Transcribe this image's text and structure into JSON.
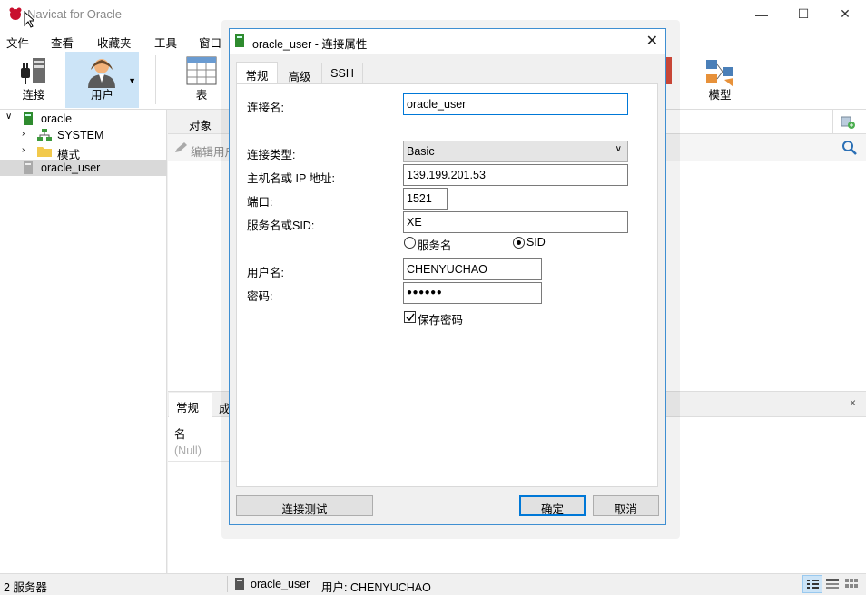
{
  "app": {
    "title": "Navicat for Oracle",
    "menu": [
      "文件",
      "查看",
      "收藏夹",
      "工具",
      "窗口"
    ],
    "toolbar": {
      "connect_label": "连接",
      "user_label": "用户",
      "table_label": "表",
      "model_label": "模型"
    },
    "tree": {
      "items": [
        {
          "label": "oracle"
        },
        {
          "label": "SYSTEM"
        },
        {
          "label": "模式"
        },
        {
          "label": "oracle_user"
        }
      ]
    },
    "content": {
      "objects_tab": "对象",
      "edit_user_partial": "编辑用户"
    },
    "lower_panel": {
      "tab_general": "常规",
      "tab_other_partial": "成",
      "name_header": "名",
      "name_value": "(Null)"
    },
    "status": {
      "servers": "2 服务器",
      "connection": "oracle_user",
      "user": "用户: CHENYUCHAO"
    }
  },
  "dialog": {
    "title": "oracle_user - 连接属性",
    "tabs": [
      "常规",
      "高级",
      "SSH"
    ],
    "form": {
      "conn_name_label": "连接名:",
      "conn_name_value": "oracle_user",
      "conn_type_label": "连接类型:",
      "conn_type_value": "Basic",
      "host_label": "主机名或 IP 地址:",
      "host_value": "139.199.201.53",
      "port_label": "端口:",
      "port_value": "1521",
      "service_label": "服务名或SID:",
      "service_value": "XE",
      "radio_service": "服务名",
      "radio_sid": "SID",
      "username_label": "用户名:",
      "username_value": "CHENYUCHAO",
      "password_label": "密码:",
      "password_value": "●●●●●●",
      "save_password_label": "保存密码"
    },
    "buttons": {
      "test": "连接测试",
      "ok": "确定",
      "cancel": "取消"
    }
  }
}
